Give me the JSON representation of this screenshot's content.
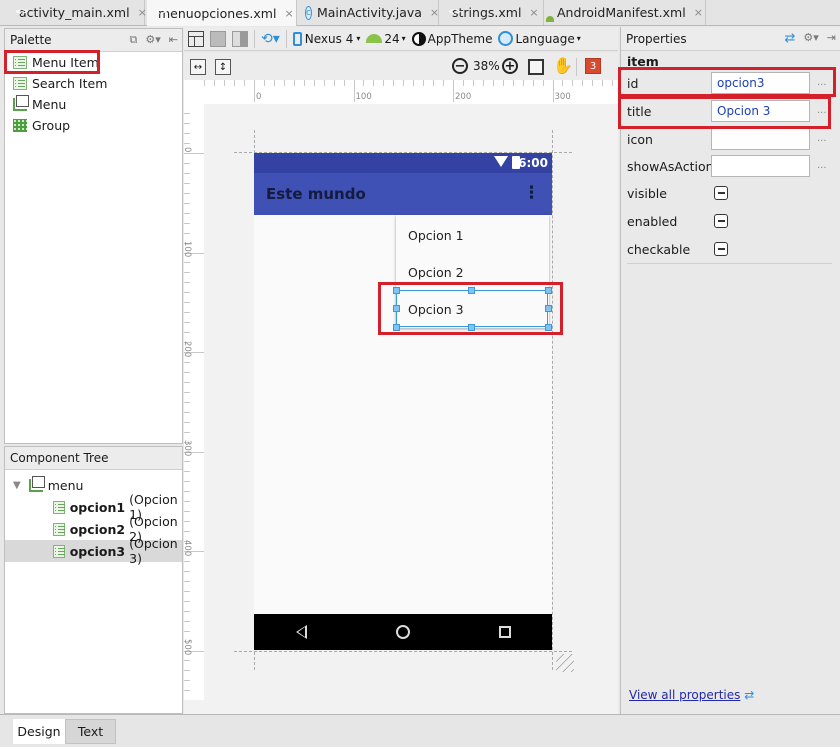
{
  "tabs": [
    {
      "label": "activity_main.xml",
      "icon": "xml-file-icon",
      "active": false
    },
    {
      "label": "menuopciones.xml",
      "icon": "xml-file-icon",
      "active": true
    },
    {
      "label": "MainActivity.java",
      "icon": "java-class-icon",
      "active": false
    },
    {
      "label": "strings.xml",
      "icon": "xml-file-icon",
      "active": false
    },
    {
      "label": "AndroidManifest.xml",
      "icon": "manifest-file-icon",
      "active": false
    }
  ],
  "tab_close_glyph": "×",
  "palette": {
    "title": "Palette",
    "items": [
      {
        "label": "Menu Item",
        "icon": "menu-item-icon"
      },
      {
        "label": "Search Item",
        "icon": "search-item-icon"
      },
      {
        "label": "Menu",
        "icon": "menu-icon"
      },
      {
        "label": "Group",
        "icon": "group-icon"
      }
    ]
  },
  "component_tree": {
    "title": "Component Tree",
    "root": "menu",
    "children": [
      {
        "id": "opcion1",
        "title": "(Opcion 1)",
        "selected": false
      },
      {
        "id": "opcion2",
        "title": "(Opcion 2)",
        "selected": false
      },
      {
        "id": "opcion3",
        "title": "(Opcion 3)",
        "selected": true
      }
    ]
  },
  "toolbar": {
    "device": "Nexus 4",
    "api_level": "24",
    "theme": "AppTheme",
    "language": "Language",
    "zoom": "38%",
    "warnings_count": "3"
  },
  "rulers": {
    "horizontal": [
      "0",
      "100",
      "200",
      "300"
    ],
    "vertical": [
      "0",
      "100",
      "200",
      "300",
      "400",
      "500"
    ]
  },
  "preview": {
    "status_time": "6:00",
    "app_title": "Este mundo",
    "overflow_glyph": "⋮",
    "menu_items": [
      "Opcion 1",
      "Opcion 2",
      "Opcion 3"
    ],
    "selected_index": 2,
    "colors": {
      "status_bar": "#3443a3",
      "app_bar": "#3f51b5",
      "nav_bar": "#000000",
      "selection": "#3a9ad9",
      "highlight": "#d4202a"
    }
  },
  "properties": {
    "title": "Properties",
    "section": "item",
    "fields": [
      {
        "label": "id",
        "value": "opcion3"
      },
      {
        "label": "title",
        "value": "Opcion 3"
      },
      {
        "label": "icon",
        "value": ""
      },
      {
        "label": "showAsAction",
        "value": ""
      }
    ],
    "checkboxes": [
      {
        "label": "visible",
        "state": "indeterminate"
      },
      {
        "label": "enabled",
        "state": "indeterminate"
      },
      {
        "label": "checkable",
        "state": "indeterminate"
      }
    ],
    "dots": "...",
    "view_all": "View all properties"
  },
  "bottom_tabs": [
    {
      "label": "Design",
      "active": true
    },
    {
      "label": "Text",
      "active": false
    }
  ]
}
